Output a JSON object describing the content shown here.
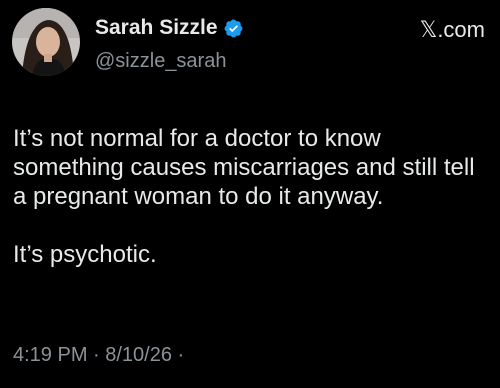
{
  "tweet": {
    "display_name": "Sarah Sizzle",
    "handle": "@sizzle_sarah",
    "verified_icon": "verified-badge",
    "brand": "𝕏.com",
    "paragraphs": [
      "It’s not normal for a doctor to know something causes miscarriages and still tell a pregnant woman to do it anyway.",
      "It’s psychotic."
    ],
    "timestamp": "4:19 PM · 8/10/26 ·"
  },
  "colors": {
    "background": "#000000",
    "text": "#e7e9ea",
    "secondary_text": "#8b9298",
    "verified_blue": "#1d9bf0"
  }
}
